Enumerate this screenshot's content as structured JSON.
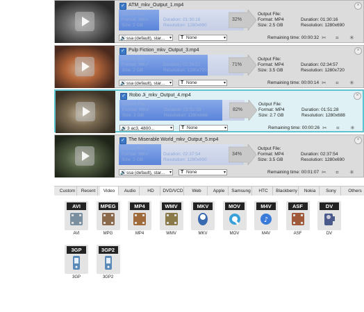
{
  "tasks": [
    {
      "filename": "ATM_mkv_Output_1.mp4",
      "source": {
        "label": "Source File:",
        "format": "Format: MKV",
        "size": "Size: 2 GB",
        "duration": "Duration: 01:30:16",
        "resolution": "Resolution: 1280x690"
      },
      "output": {
        "label": "Output File:",
        "format": "Format: MP4",
        "size": "Size: 2.5 GB",
        "duration": "Duration: 01:30:16",
        "resolution": "Resolution: 1280x690"
      },
      "progress_percent": 32,
      "percent_label": "32%",
      "audio": "ssa (default), star...",
      "subtitle": "None",
      "remaining": "Remaining time: 00:00:32",
      "selected": false,
      "scene_colors": [
        "#2a2a2a",
        "#6a6a6a",
        "#a8a8a8"
      ]
    },
    {
      "filename": "Pulp Fiction_mkv_Output_3.mp4",
      "source": {
        "label": "Source File:",
        "format": "Format: MKV",
        "size": "Size: 2 GB",
        "duration": "Duration: 02:34:57",
        "resolution": "Resolution: 1280x720"
      },
      "output": {
        "label": "Output File:",
        "format": "Format: MP4",
        "size": "Size: 3.5 GB",
        "duration": "Duration: 02:34:57",
        "resolution": "Resolution: 1280x720"
      },
      "progress_percent": 71,
      "percent_label": "71%",
      "audio": "ssa (default), star...",
      "subtitle": "None",
      "remaining": "Remaining time: 00:00:14",
      "selected": false,
      "scene_colors": [
        "#4a2a1e",
        "#b0643a",
        "#d8b090"
      ]
    },
    {
      "filename": "Robo Ji_mkv_Output_4.mp4",
      "source": {
        "label": "Source File:",
        "format": "Format: MKV",
        "size": "Size: 2 GB",
        "duration": "Duration: 01:51:28",
        "resolution": "Resolution: 1280x688"
      },
      "output": {
        "label": "Output File:",
        "format": "Format: MP4",
        "size": "Size: 2.7 GB",
        "duration": "Duration: 01:51:28",
        "resolution": "Resolution: 1280x688"
      },
      "progress_percent": 82,
      "percent_label": "82%",
      "audio": "3 ac3, 4800...",
      "subtitle": "None",
      "remaining": "Remaining time: 00:00:26",
      "selected": true,
      "scene_colors": [
        "#3a3226",
        "#7a6a52",
        "#c8b89a"
      ]
    },
    {
      "filename": "The Miserable World_mkv_Output_5.mp4",
      "source": {
        "label": "Source File:",
        "format": "Format: MKV",
        "size": "Size: 2 GB",
        "duration": "Duration: 02:37:54",
        "resolution": "Resolution: 1280x690"
      },
      "output": {
        "label": "Output File:",
        "format": "Format: MP4",
        "size": "Size: 3.5 GB",
        "duration": "Duration: 02:37:54",
        "resolution": "Resolution: 1280x690"
      },
      "progress_percent": 34,
      "percent_label": "34%",
      "audio": "ssa (default), star...",
      "subtitle": "None",
      "remaining": "Remaining time: 00:01:07",
      "selected": false,
      "scene_colors": [
        "#1e2418",
        "#4e5a40",
        "#8a9478"
      ]
    }
  ],
  "tabs": [
    "Custom",
    "Recent",
    "Video",
    "Audio",
    "HD",
    "DVD/VCD",
    "Web",
    "Apple",
    "Samsung",
    "HTC",
    "Blackberry",
    "Nokia",
    "Sony",
    "Others"
  ],
  "active_tab": "Video",
  "formats": [
    {
      "badge": "AVI",
      "label": "AVI",
      "icon": "film-icon",
      "color": "#7a8fa0"
    },
    {
      "badge": "MPEG",
      "label": "MPG",
      "icon": "film-icon",
      "color": "#8a6a4a"
    },
    {
      "badge": "MP4",
      "label": "MP4",
      "icon": "film-icon",
      "color": "#a06a3a"
    },
    {
      "badge": "WMV",
      "label": "WMV",
      "icon": "film-icon",
      "color": "#8a7a4a"
    },
    {
      "badge": "MKV",
      "label": "MKV",
      "icon": "matroska-icon",
      "color": "#3a6ab0"
    },
    {
      "badge": "MOV",
      "label": "MOV",
      "icon": "quicktime-icon",
      "color": "#3aa0d8"
    },
    {
      "badge": "M4V",
      "label": "M4V",
      "icon": "itunes-icon",
      "color": "#3a7ad8"
    },
    {
      "badge": "ASF",
      "label": "ASF",
      "icon": "film-icon",
      "color": "#a05a3a"
    },
    {
      "badge": "DV",
      "label": "DV",
      "icon": "camcorder-icon",
      "color": "#4a5a8a"
    },
    {
      "badge": "3GP",
      "label": "3GP",
      "icon": "phone-icon",
      "color": "#5a8ab8"
    },
    {
      "badge": "3GP2",
      "label": "3GP2",
      "icon": "phone-icon",
      "color": "#5a8ab8"
    }
  ]
}
